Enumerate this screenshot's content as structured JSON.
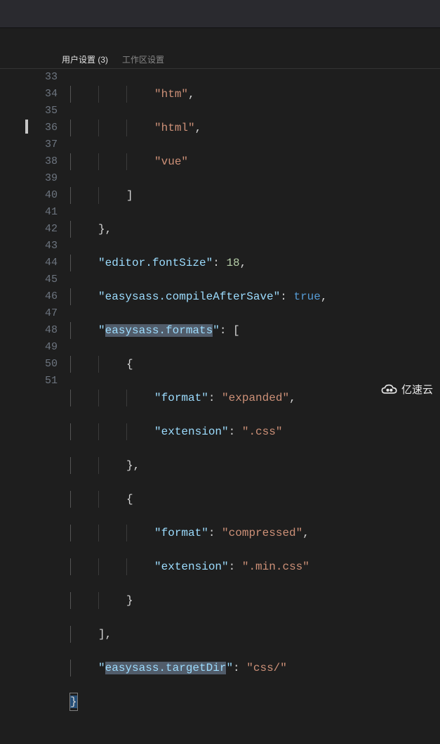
{
  "tabs": {
    "user": "用户设置 (3)",
    "workspace": "工作区设置"
  },
  "lines": {
    "start": 33,
    "end": 51
  },
  "code": {
    "l33": "htm",
    "l34": "html",
    "l35": "vue",
    "l38_key": "editor.fontSize",
    "l38_val": "18",
    "l39_key": "easysass.compileAfterSave",
    "l39_val": "true",
    "l40_key": "easysass.formats",
    "l42_key": "format",
    "l42_val": "expanded",
    "l43_key": "extension",
    "l43_val": ".css",
    "l46_key": "format",
    "l46_val": "compressed",
    "l47_key": "extension",
    "l47_val": ".min.css",
    "l50_key": "easysass.targetDir",
    "l50_val": "css/"
  },
  "logo_text": "亿速云"
}
